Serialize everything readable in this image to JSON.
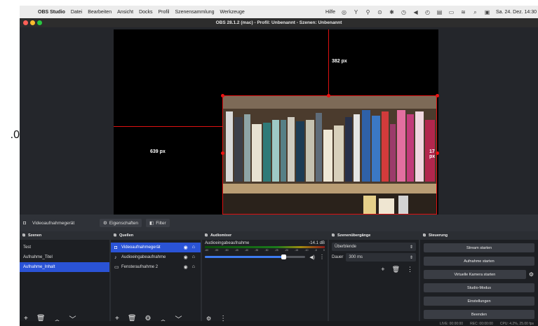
{
  "menubar": {
    "apple": "",
    "app_name": "OBS Studio",
    "items": [
      "Datei",
      "Bearbeiten",
      "Ansicht",
      "Docks",
      "Profil",
      "Szenensammlung",
      "Werkzeuge"
    ],
    "help": "Hilfe",
    "datetime": "Sa. 24. Dez. 14:30"
  },
  "window": {
    "title": "OBS 28.1.2 (mac) - Profil: Unbenannt - Szenen: Unbenannt"
  },
  "preview": {
    "top_label": "382 px",
    "left_label": "639 px",
    "right_label": "17 px"
  },
  "cutoff_number": ".0",
  "source_toolbar": {
    "source_name": "Videoaufnahmegerät",
    "properties": "Eigenschaften",
    "filter": "Filter"
  },
  "scenes": {
    "title": "Szenen",
    "items": [
      {
        "label": "Test"
      },
      {
        "label": "Aufnahme_Titel"
      },
      {
        "label": "Aufnahme_Inhalt"
      }
    ]
  },
  "sources": {
    "title": "Quellen",
    "items": [
      {
        "label": "Videoaufnahmegerät"
      },
      {
        "label": "Audioeingabeaufnahme"
      },
      {
        "label": "Fensteraufnahme 2"
      }
    ]
  },
  "mixer": {
    "title": "Audiomixer",
    "channel": "Audioeingabeaufnahme",
    "level": "-14.1 dB",
    "ticks": [
      "-60",
      "-55",
      "-50",
      "-45",
      "-40",
      "-35",
      "-30",
      "-25",
      "-20",
      "-15",
      "-10",
      "-5",
      "0"
    ],
    "volume_fraction": 0.78
  },
  "transitions": {
    "title": "Szenenübergänge",
    "selected": "Überblende",
    "duration_label": "Dauer",
    "duration_value": "300 ms"
  },
  "controls": {
    "title": "Steuerung",
    "buttons": [
      "Stream starten",
      "Aufnahme starten",
      "Virtuelle Kamera starten",
      "Studio-Modus",
      "Einstellungen",
      "Beenden"
    ]
  },
  "status": {
    "live": "LIVE: 00:00:00",
    "rec": "REC: 00:00:00",
    "cpu": "CPU: 4.2%, 25.00 fps"
  },
  "colors": {
    "selection": "#2a53d6",
    "crop_line": "#dd1111",
    "dock_bg": "#1d1f23"
  }
}
